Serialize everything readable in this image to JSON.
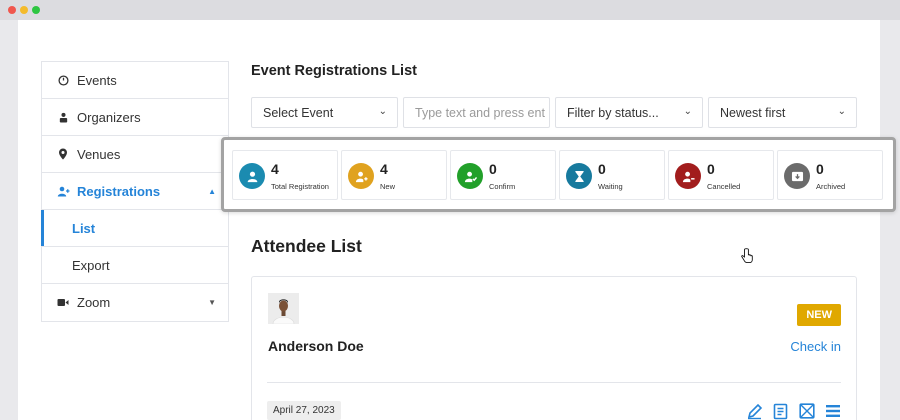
{
  "colors": {
    "accent": "#2584d8",
    "new_badge": "#e0a800"
  },
  "sidebar": {
    "items": [
      {
        "label": "Events",
        "icon": "dashboard-gauge-icon"
      },
      {
        "label": "Organizers",
        "icon": "organizer-person-icon"
      },
      {
        "label": "Venues",
        "icon": "map-pin-icon"
      },
      {
        "label": "Registrations",
        "icon": "registrations-users-icon",
        "expanded": true
      },
      {
        "label": "List",
        "current": true
      },
      {
        "label": "Export"
      },
      {
        "label": "Zoom",
        "icon": "video-camera-icon",
        "collapsed": true
      }
    ]
  },
  "main": {
    "title": "Event Registrations List",
    "filters": {
      "event_select": "Select Event",
      "search_placeholder": "Type text and press ent",
      "status_select": "Filter by status...",
      "sort_select": "Newest first"
    },
    "stats": [
      {
        "count": "4",
        "label": "Total Registration",
        "color": "#1b8bb0",
        "icon": "user-icon"
      },
      {
        "count": "4",
        "label": "New",
        "color": "#e0a21f",
        "icon": "user-plus-icon"
      },
      {
        "count": "0",
        "label": "Confirm",
        "color": "#22a02a",
        "icon": "user-check-icon"
      },
      {
        "count": "0",
        "label": "Waiting",
        "color": "#177a9e",
        "icon": "hourglass-icon"
      },
      {
        "count": "0",
        "label": "Cancelled",
        "color": "#a21d1d",
        "icon": "user-minus-icon"
      },
      {
        "count": "0",
        "label": "Archived",
        "color": "#6b6b6b",
        "icon": "archive-box-icon"
      }
    ],
    "attendee_heading": "Attendee List",
    "attendee": {
      "name": "Anderson Doe",
      "badge": "NEW",
      "checkin_label": "Check in",
      "date": "April 27, 2023",
      "actions": [
        "edit-pen-icon",
        "document-icon",
        "envelope-icon",
        "menu-lines-icon"
      ]
    }
  }
}
